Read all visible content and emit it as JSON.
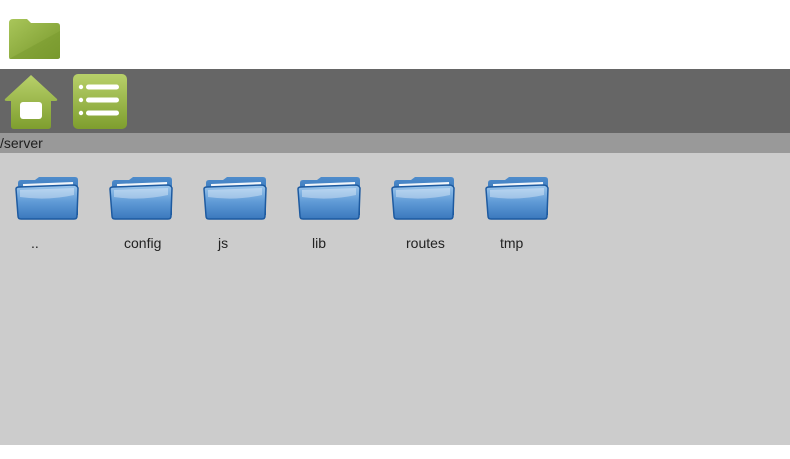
{
  "header": {
    "logo_icon": "folder-icon",
    "accent_color": "#8fb040"
  },
  "toolbar": {
    "buttons": [
      {
        "icon": "home-icon"
      },
      {
        "icon": "list-icon"
      }
    ]
  },
  "path": {
    "current": "/server"
  },
  "files": {
    "items": [
      {
        "label": "..",
        "icon": "folder-icon"
      },
      {
        "label": "config",
        "icon": "folder-icon"
      },
      {
        "label": "js",
        "icon": "folder-icon"
      },
      {
        "label": "lib",
        "icon": "folder-icon"
      },
      {
        "label": "routes",
        "icon": "folder-icon"
      },
      {
        "label": "tmp",
        "icon": "folder-icon"
      }
    ]
  }
}
